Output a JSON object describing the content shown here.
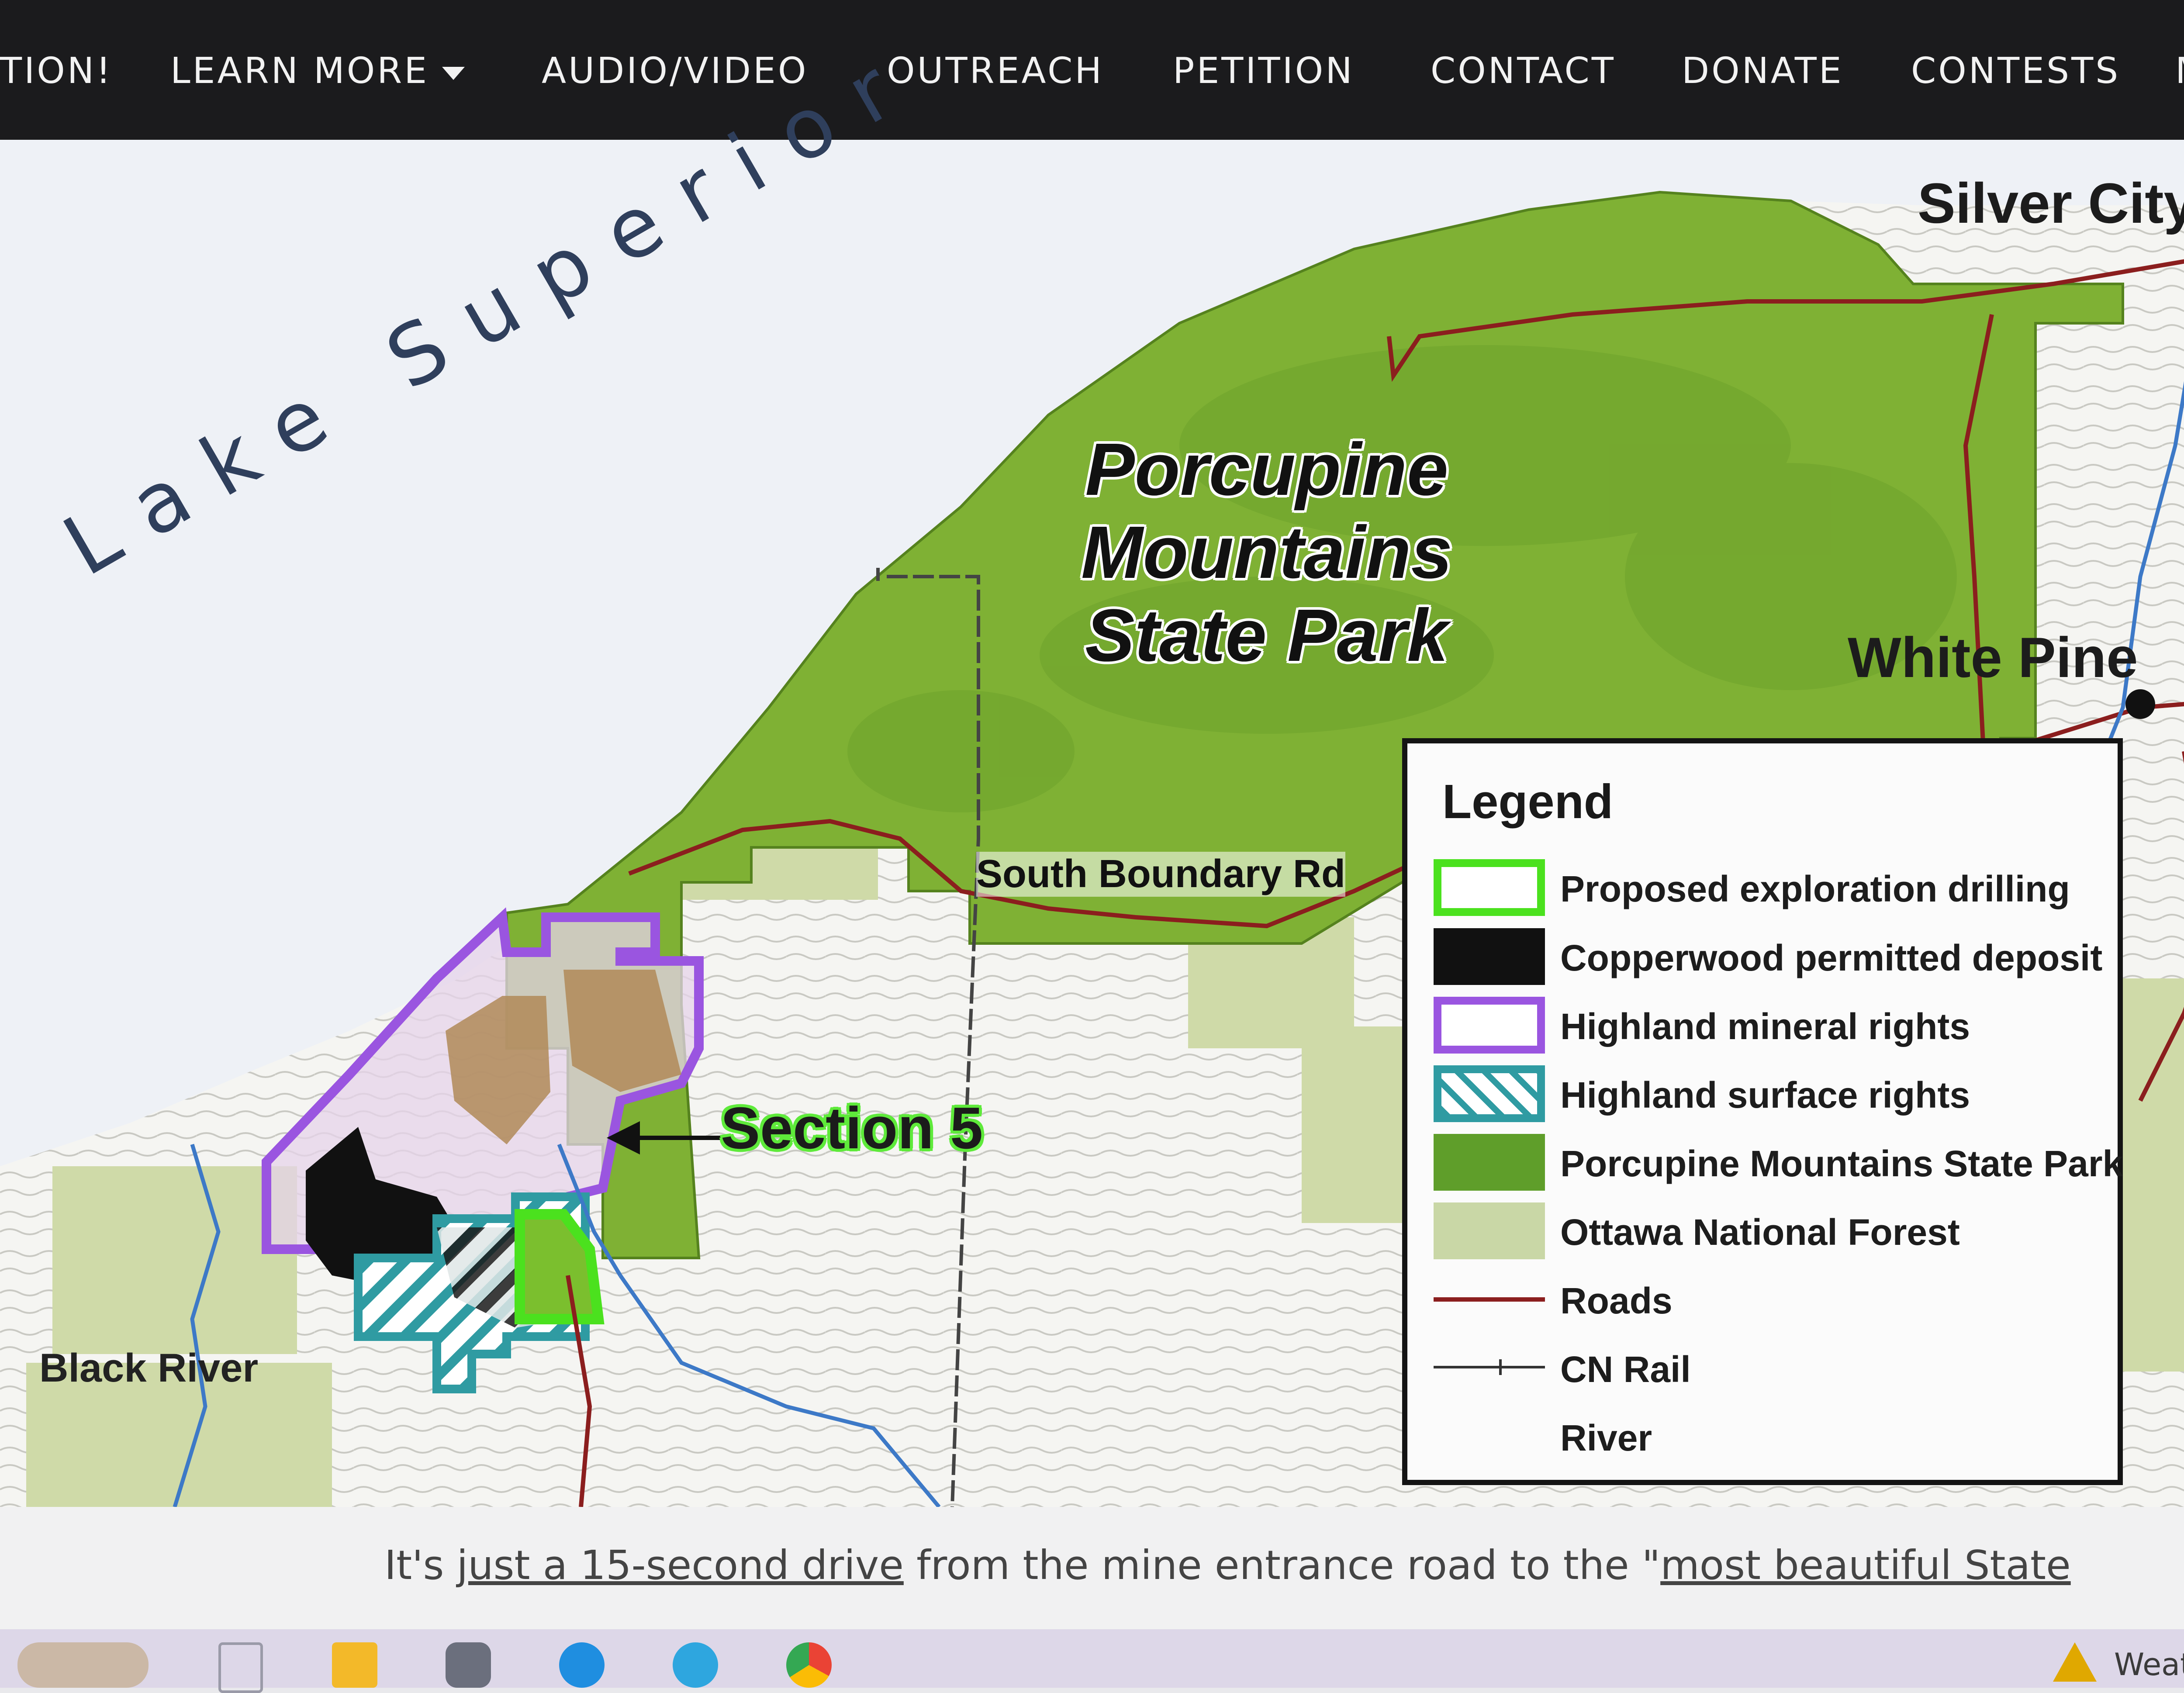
{
  "nav": {
    "items": [
      {
        "label": "TION!"
      },
      {
        "label": "LEARN MORE"
      },
      {
        "label": "AUDIO/VIDEO"
      },
      {
        "label": "OUTREACH"
      },
      {
        "label": "PETITION"
      },
      {
        "label": "CONTACT"
      },
      {
        "label": "DONATE"
      },
      {
        "label": "CONTESTS"
      },
      {
        "label": "MER"
      }
    ]
  },
  "map": {
    "lake_label": "Lake Superior",
    "park_title_line1": "Porcupine Mountains",
    "park_title_line2": "State Park",
    "places": {
      "silver_city": "Silver City",
      "white_pine": "White Pine",
      "black_river": "Black River",
      "south_boundary_rd": "South Boundary Rd"
    },
    "section_label": "Section 5",
    "legend": {
      "title": "Legend",
      "items": [
        {
          "label": "Proposed exploration drilling",
          "swatch": "outline",
          "color": "#4be11e"
        },
        {
          "label": "Copperwood permitted deposit",
          "swatch": "fill",
          "color": "#111111"
        },
        {
          "label": "Highland mineral rights",
          "swatch": "outline",
          "color": "#9a55e0"
        },
        {
          "label": "Highland surface rights",
          "swatch": "hatched",
          "color": "#2f9ba2"
        },
        {
          "label": "Porcupine Mountains State Park",
          "swatch": "fill",
          "color": "#5f9e2a"
        },
        {
          "label": "Ottawa National Forest",
          "swatch": "fill",
          "color": "#c9d7a6"
        },
        {
          "label": "Roads",
          "swatch": "line",
          "color": "#8b1e1e"
        },
        {
          "label": "CN Rail",
          "swatch": "rail",
          "color": "#333333"
        },
        {
          "label": "River",
          "swatch": "none",
          "color": "#3d79c7"
        }
      ]
    },
    "colors": {
      "lake": "#eef1f6",
      "park": "#7fb134",
      "forest": "#d2dcb2",
      "land": "#f3f4f1",
      "road": "#8b1e1e",
      "river": "#3d79c7"
    }
  },
  "caption": {
    "prefix": "It's ",
    "link1": "just a 15-second drive",
    "middle": " from the mine entrance road to the \"",
    "link2": "most beautiful State"
  },
  "taskbar": {
    "weather_label": "Weather"
  }
}
